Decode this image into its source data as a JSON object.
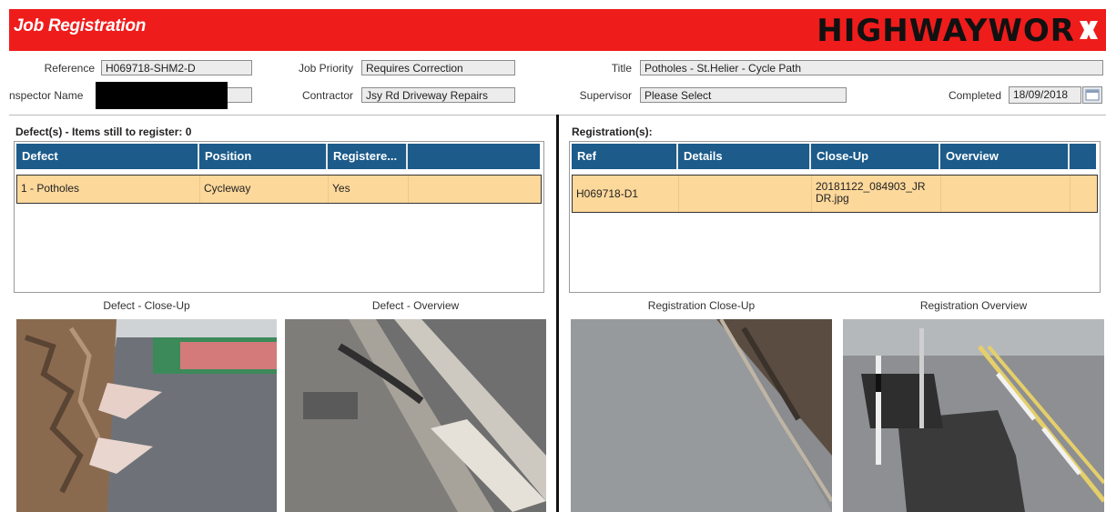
{
  "app": {
    "title": "Job Registration",
    "brand": "HIGHWAYWOR"
  },
  "form": {
    "reference": {
      "label": "Reference",
      "value": "H069718-SHM2-D"
    },
    "job_priority": {
      "label": "Job Priority",
      "value": "Requires Correction"
    },
    "title": {
      "label": "Title",
      "value": "Potholes - St.Helier - Cycle Path"
    },
    "inspector": {
      "label": "nspector Name"
    },
    "contractor": {
      "label": "Contractor",
      "value": "Jsy Rd Driveway Repairs"
    },
    "supervisor": {
      "label": "Supervisor",
      "value": "Please Select"
    },
    "completed": {
      "label": "Completed",
      "value": "18/09/2018"
    }
  },
  "defects": {
    "title": "Defect(s) - Items still to register: 0",
    "columns": [
      "Defect",
      "Position",
      "Registere..."
    ],
    "rows": [
      {
        "defect": "1 - Potholes",
        "position": "Cycleway",
        "registered": "Yes"
      }
    ]
  },
  "registrations": {
    "title": "Registration(s):",
    "columns": [
      "Ref",
      "Details",
      "Close-Up",
      "Overview"
    ],
    "rows": [
      {
        "ref": "H069718-D1",
        "details": "",
        "closeup": "20181122_084903_JR DR.jpg",
        "overview": ""
      }
    ]
  },
  "captions": {
    "defect_closeup": "Defect - Close-Up",
    "defect_overview": "Defect - Overview",
    "reg_closeup": "Registration Close-Up",
    "reg_overview": "Registration Overview"
  }
}
